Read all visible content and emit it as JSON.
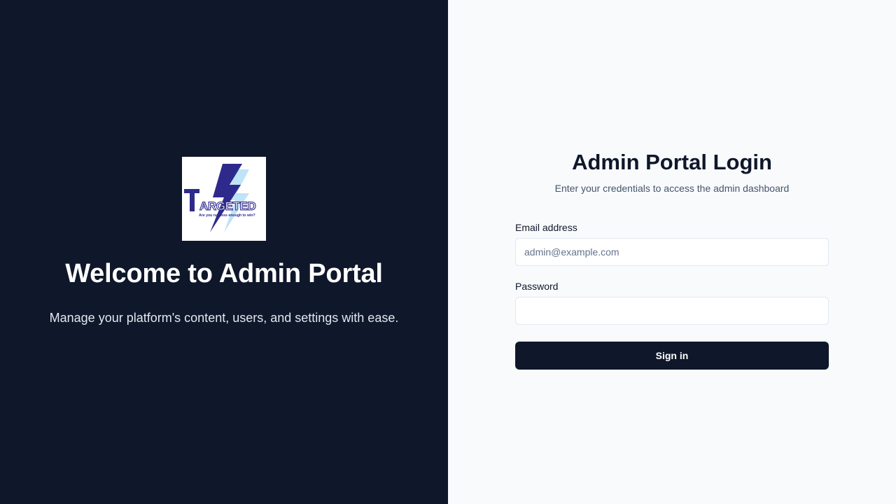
{
  "hero": {
    "logo": {
      "icon": "targeted-lightning-logo",
      "brand_text": "TARGETED",
      "tagline": "Are you ruthless enough to win?"
    },
    "title": "Welcome to Admin Portal",
    "subtitle": "Manage your platform's content, users, and settings with ease."
  },
  "login": {
    "title": "Admin Portal Login",
    "subtitle": "Enter your credentials to access the admin dashboard",
    "email": {
      "label": "Email address",
      "placeholder": "admin@example.com",
      "value": ""
    },
    "password": {
      "label": "Password",
      "placeholder": "",
      "value": ""
    },
    "submit_label": "Sign in"
  },
  "colors": {
    "hero_bg": "#0f172a",
    "login_bg": "#f8fafc",
    "primary": "#0f172a",
    "logo_blue": "#2e2a8c",
    "logo_light_blue": "#bfe3f7"
  }
}
